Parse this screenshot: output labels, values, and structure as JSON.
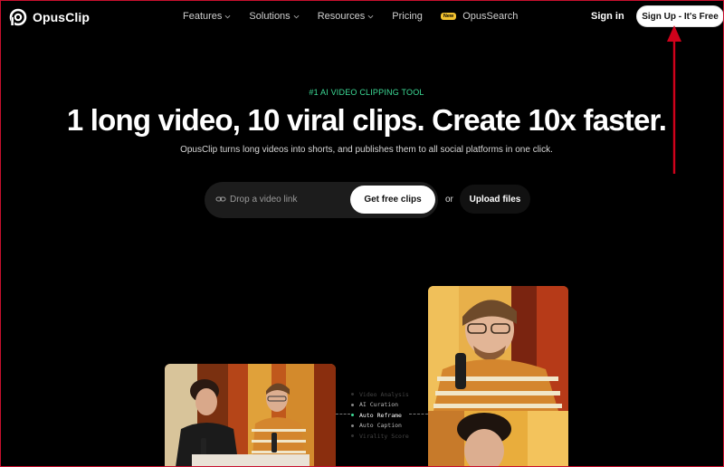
{
  "brand": {
    "name": "OpusClip",
    "logo_icon": "opusclip-logo-icon"
  },
  "nav": {
    "items": [
      {
        "label": "Features",
        "has_dropdown": true
      },
      {
        "label": "Solutions",
        "has_dropdown": true
      },
      {
        "label": "Resources",
        "has_dropdown": true
      },
      {
        "label": "Pricing",
        "has_dropdown": false
      }
    ],
    "search_badge": "New",
    "search_label": "OpusSearch",
    "signin_label": "Sign in",
    "signup_label": "Sign Up - It's Free"
  },
  "hero": {
    "eyebrow": "#1 AI VIDEO CLIPPING TOOL",
    "headline": "1 long video, 10 viral clips. Create 10x faster.",
    "subline": "OpusClip turns long videos into shorts, and publishes them to all social platforms in one click.",
    "input_placeholder": "Drop a video link",
    "get_clips_label": "Get free clips",
    "or_label": "or",
    "upload_label": "Upload files"
  },
  "features": [
    {
      "label": "Video Analysis",
      "state": "dim"
    },
    {
      "label": "AI Curation",
      "state": "normal"
    },
    {
      "label": "Auto Reframe",
      "state": "active"
    },
    {
      "label": "Auto Caption",
      "state": "normal"
    },
    {
      "label": "Virality Score",
      "state": "dim"
    }
  ],
  "colors": {
    "accent_green": "#3ddc97",
    "annotation_red": "#d0021b",
    "badge_yellow": "#f2c230",
    "background": "#000000"
  }
}
